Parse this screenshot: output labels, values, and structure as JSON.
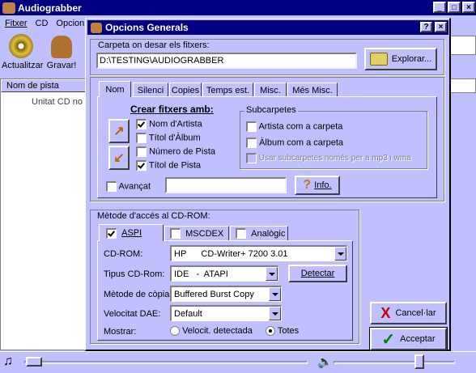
{
  "main_window": {
    "title": "Audiograbber",
    "menu": [
      "Fitxer",
      "CD",
      "Opcion"
    ],
    "toolbar": {
      "refresh_label": "Actualitzar",
      "record_label": "Gravar!"
    },
    "list_header": "Nom de pista",
    "list_empty_text": "Unitat CD no"
  },
  "dialog": {
    "title": "Opcions Generals",
    "folder": {
      "label": "Carpeta on desar els fitxers:",
      "path": "D:\\TESTING\\AUDIOGRABBER",
      "browse_label": "Explorar..."
    },
    "tabs": [
      "Nom",
      "Silenci",
      "Copies",
      "Temps est.",
      "Misc.",
      "Més Misc."
    ],
    "create_files": {
      "heading": "Crear fitxers amb:",
      "options": [
        {
          "label": "Nom d'Artista",
          "checked": true
        },
        {
          "label": "Títol d'Àlbum",
          "checked": false
        },
        {
          "label": "Número de Pista",
          "checked": false
        },
        {
          "label": "Títol de Pista",
          "checked": true
        }
      ]
    },
    "subfolders": {
      "legend": "Subcarpetes",
      "options": [
        {
          "label": "Artista com a carpeta",
          "checked": false,
          "enabled": true
        },
        {
          "label": "Àlbum com a carpeta",
          "checked": false,
          "enabled": true
        },
        {
          "label": "Usar subcarpetes només per a mp3 i wma",
          "checked": false,
          "enabled": false
        }
      ]
    },
    "advanced": {
      "label": "Avançat",
      "checked": false,
      "value": ""
    },
    "info_label": "Info.",
    "cdrom": {
      "legend": "Mètode d'accés al CD-ROM:",
      "method_tabs": [
        {
          "label": "ASPI",
          "checked": true
        },
        {
          "label": "MSCDEX",
          "checked": false
        },
        {
          "label": "Analògic",
          "checked": false
        }
      ],
      "fields": {
        "cdrom_label": "CD-ROM:",
        "cdrom_value": "HP      CD-Writer+ 7200 3.01",
        "type_label": "Tipus CD-Rom:",
        "type_value": "IDE   -  ATAPI",
        "detect_label": "Detectar",
        "copy_label": "Mètode de còpia:",
        "copy_value": "Buffered Burst Copy",
        "dae_label": "Velocitat DAE:",
        "dae_value": "Default",
        "show_label": "Mostrar:",
        "show_options": [
          {
            "label": "Velocit. detectada",
            "selected": false
          },
          {
            "label": "Totes",
            "selected": true
          }
        ]
      }
    },
    "cancel_label": "Cancel·lar",
    "ok_label": "Acceptar"
  },
  "colors": {
    "titlebar": "#000080",
    "face": "#c0c0ff"
  }
}
